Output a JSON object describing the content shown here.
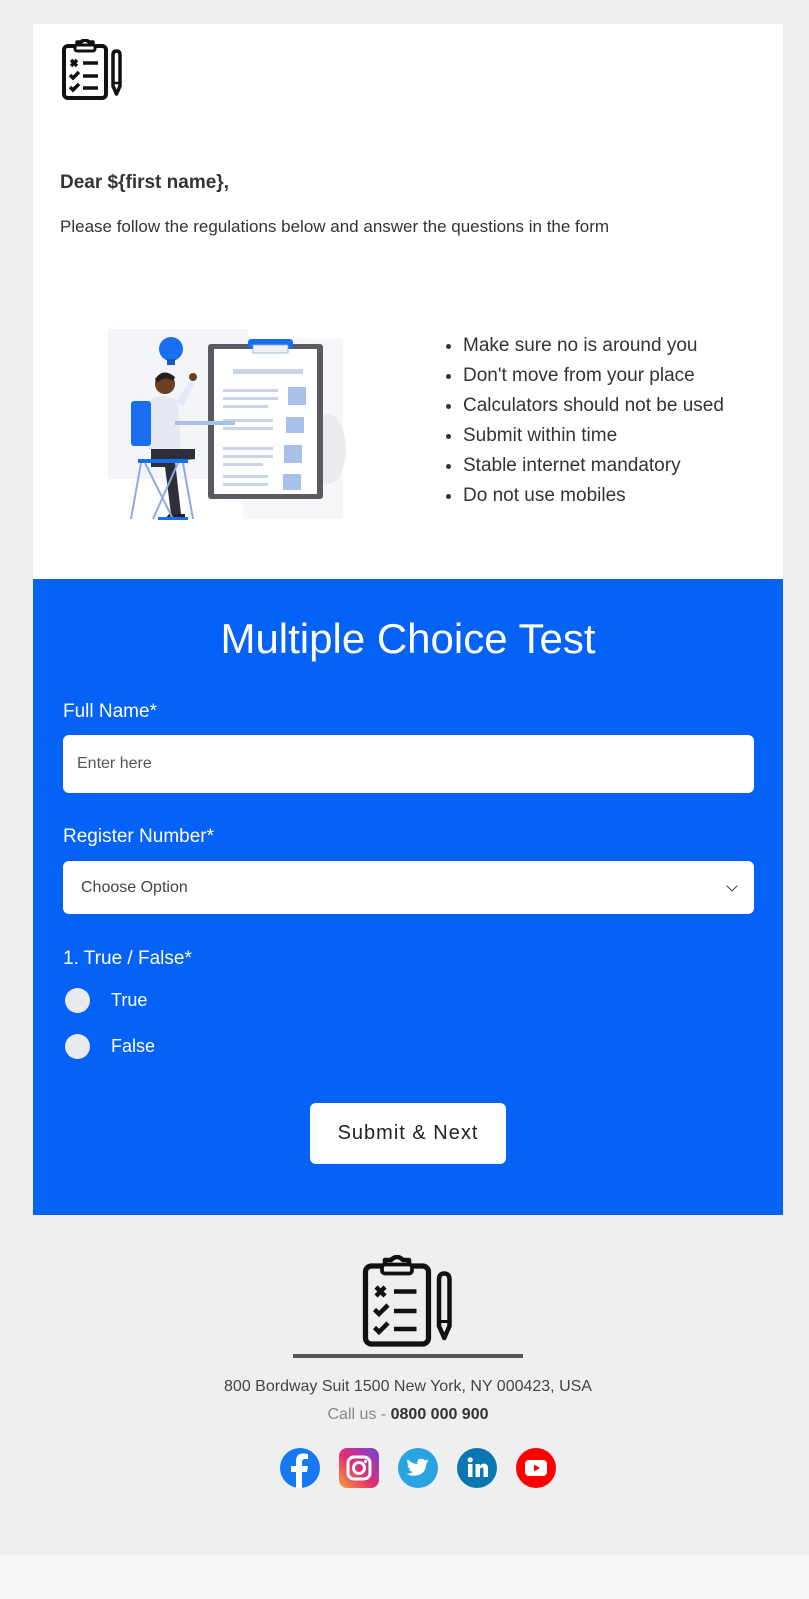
{
  "header": {
    "logo_icon": "clipboard-checklist-icon",
    "greeting": "Dear ${first name},",
    "intro": "Please follow the regulations below and answer the questions in the form"
  },
  "illustration": {
    "icon": "person-at-desk-with-clipboard-illustration"
  },
  "rules": [
    "Make sure no is around you",
    "Don't move from your place",
    "Calculators should not be used",
    "Submit within time",
    "Stable internet mandatory",
    "Do not use mobiles"
  ],
  "form": {
    "title": "Multiple Choice Test",
    "full_name_label": "Full Name*",
    "full_name_placeholder": "Enter here",
    "full_name_value": "",
    "register_label": "Register Number*",
    "register_selected": "Choose Option",
    "question_label": "1. True / False*",
    "options": [
      "True",
      "False"
    ],
    "submit_label": "Submit & Next",
    "accent_color": "#0462f6"
  },
  "footer": {
    "logo_icon": "clipboard-checklist-icon",
    "address": "800 Bordway Suit 1500 New York, NY 000423, USA",
    "call_prefix": "Call us - ",
    "phone": "0800 000 900",
    "socials": [
      {
        "name": "facebook",
        "icon": "facebook-icon",
        "color": "#1877f2"
      },
      {
        "name": "instagram",
        "icon": "instagram-icon",
        "color": "#e1306c"
      },
      {
        "name": "twitter",
        "icon": "twitter-icon",
        "color": "#2aa3e2"
      },
      {
        "name": "linkedin",
        "icon": "linkedin-icon",
        "color": "#0b76b0"
      },
      {
        "name": "youtube",
        "icon": "youtube-icon",
        "color": "#ff0000"
      }
    ]
  }
}
